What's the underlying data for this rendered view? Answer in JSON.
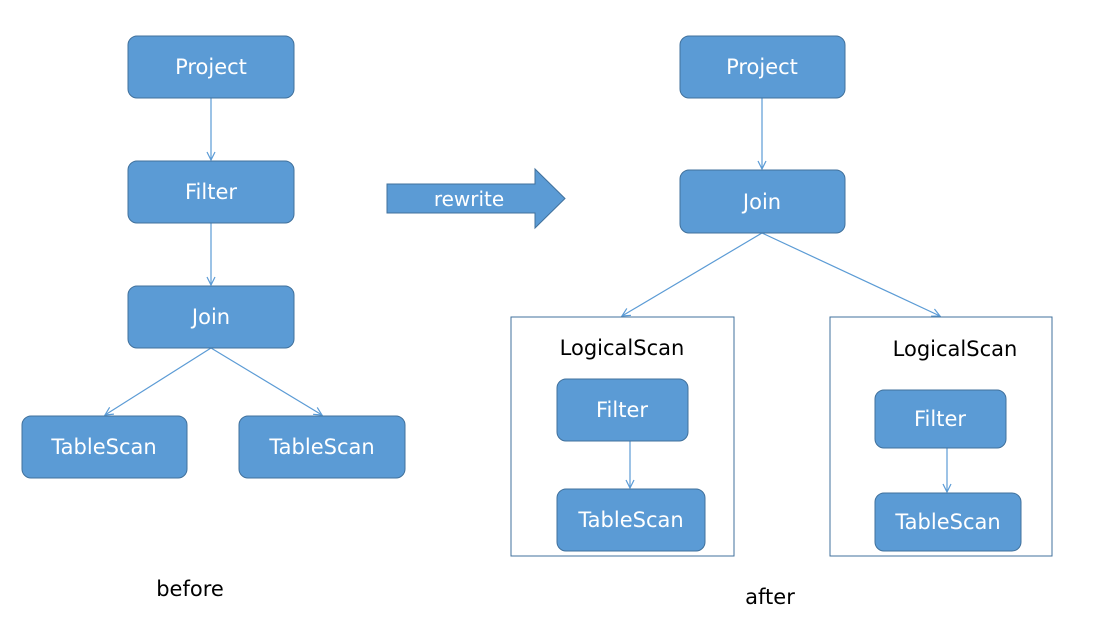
{
  "colors": {
    "node_fill": "#5b9bd5",
    "node_stroke": "#41719c"
  },
  "before": {
    "caption": "before",
    "nodes": [
      "Project",
      "Filter",
      "Join",
      "TableScan",
      "TableScan"
    ]
  },
  "rewrite_arrow": {
    "label": "rewrite"
  },
  "after": {
    "caption": "after",
    "nodes": [
      "Project",
      "Join"
    ],
    "groups": [
      {
        "title": "LogicalScan",
        "nodes": [
          "Filter",
          "TableScan"
        ]
      },
      {
        "title": "LogicalScan",
        "nodes": [
          "Filter",
          "TableScan"
        ]
      }
    ]
  }
}
